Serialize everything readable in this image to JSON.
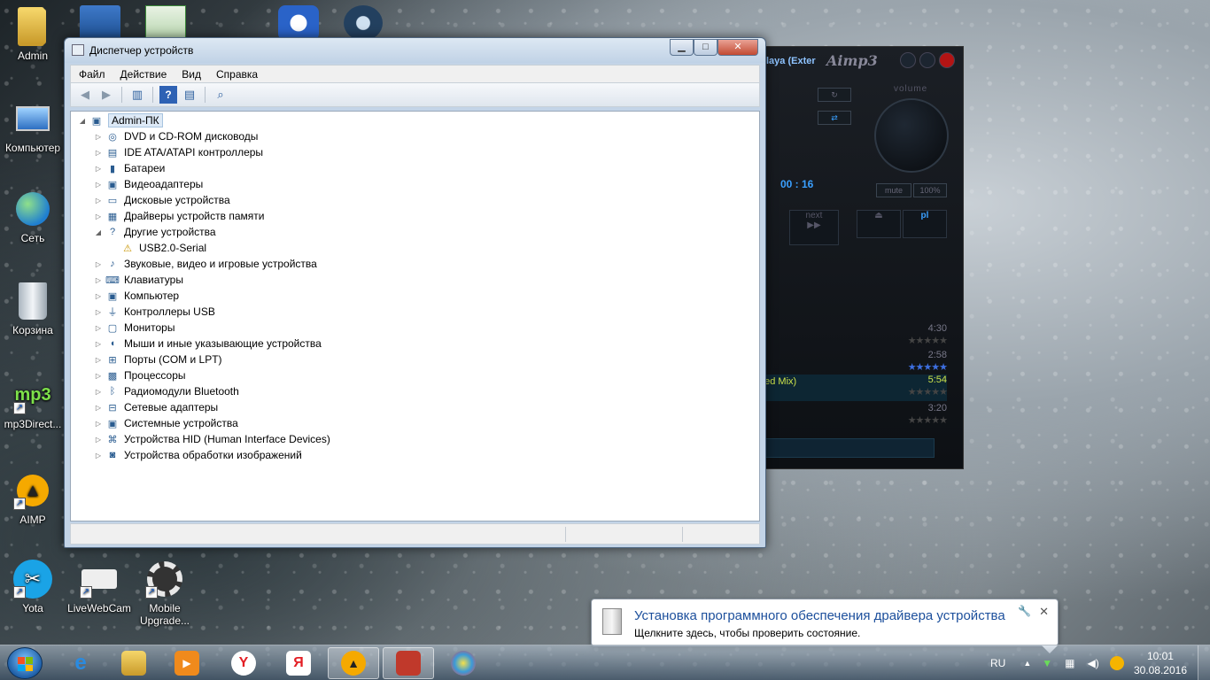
{
  "desktop": {
    "icons": [
      {
        "label": "Admin"
      },
      {
        "label": "Компьютер"
      },
      {
        "label": "Сеть"
      },
      {
        "label": "Корзина"
      },
      {
        "label": "mp3Direct..."
      },
      {
        "label": "AIMP"
      },
      {
        "label": "Yota"
      },
      {
        "label": "LiveWebCam"
      },
      {
        "label": "Mobile Upgrade..."
      }
    ]
  },
  "aimp": {
    "scroll_title": "laya (Exter",
    "logo": "Aimp3",
    "volume_label": "volume",
    "time": "00 : 16",
    "mute_label": "mute",
    "percent_label": "100%",
    "next_label": "next",
    "pl_label": "pl",
    "playlist": [
      {
        "duration": "4:30",
        "stars": "★★★★★"
      },
      {
        "duration": "2:58",
        "stars": "★★★★★"
      },
      {
        "track": "ded Mix)",
        "duration": "5:54",
        "stars": "★★★★★"
      },
      {
        "duration": "3:20",
        "stars": "★★★★★"
      }
    ]
  },
  "window": {
    "title": "Диспетчер устройств",
    "menu": [
      "Файл",
      "Действие",
      "Вид",
      "Справка"
    ],
    "root": "Admin-ПК",
    "devices": [
      {
        "label": "DVD и CD-ROM дисководы",
        "icon": "dvd-drive-icon",
        "glyph": "◎"
      },
      {
        "label": "IDE ATA/ATAPI контроллеры",
        "icon": "ide-controller-icon",
        "glyph": "▤"
      },
      {
        "label": "Батареи",
        "icon": "battery-icon",
        "glyph": "▮"
      },
      {
        "label": "Видеоадаптеры",
        "icon": "display-adapter-icon",
        "glyph": "▣"
      },
      {
        "label": "Дисковые устройства",
        "icon": "disk-drive-icon",
        "glyph": "▭"
      },
      {
        "label": "Драйверы устройств памяти",
        "icon": "memory-driver-icon",
        "glyph": "▦"
      },
      {
        "label": "Другие устройства",
        "icon": "other-devices-icon",
        "glyph": "?",
        "expanded": true
      },
      {
        "label": "USB2.0-Serial",
        "icon": "warning-device-icon",
        "glyph": "⚠",
        "child": true
      },
      {
        "label": "Звуковые, видео и игровые устройства",
        "icon": "sound-icon",
        "glyph": "♪"
      },
      {
        "label": "Клавиатуры",
        "icon": "keyboard-icon",
        "glyph": "⌨"
      },
      {
        "label": "Компьютер",
        "icon": "computer-icon",
        "glyph": "▣"
      },
      {
        "label": "Контроллеры USB",
        "icon": "usb-icon",
        "glyph": "⏚"
      },
      {
        "label": "Мониторы",
        "icon": "monitor-icon",
        "glyph": "▢"
      },
      {
        "label": "Мыши и иные указывающие устройства",
        "icon": "mouse-icon",
        "glyph": "◖"
      },
      {
        "label": "Порты (COM и LPT)",
        "icon": "port-icon",
        "glyph": "⊞"
      },
      {
        "label": "Процессоры",
        "icon": "processor-icon",
        "glyph": "▩"
      },
      {
        "label": "Радиомодули Bluetooth",
        "icon": "bluetooth-icon",
        "glyph": "ᛒ"
      },
      {
        "label": "Сетевые адаптеры",
        "icon": "network-adapter-icon",
        "glyph": "⊟"
      },
      {
        "label": "Системные устройства",
        "icon": "system-device-icon",
        "glyph": "▣"
      },
      {
        "label": "Устройства HID (Human Interface Devices)",
        "icon": "hid-icon",
        "glyph": "⌘"
      },
      {
        "label": "Устройства обработки изображений",
        "icon": "imaging-device-icon",
        "glyph": "◙"
      }
    ]
  },
  "balloon": {
    "title": "Установка программного обеспечения драйвера устройства",
    "text": "Щелкните здесь, чтобы проверить состояние."
  },
  "taskbar": {
    "language": "RU",
    "time": "10:01",
    "date": "30.08.2016",
    "yandex_glyph": "Я"
  },
  "colors": {
    "accent": "#1c4f9c",
    "aimp_time": "#3aa0ff",
    "aimp_active": "#cde34a"
  }
}
